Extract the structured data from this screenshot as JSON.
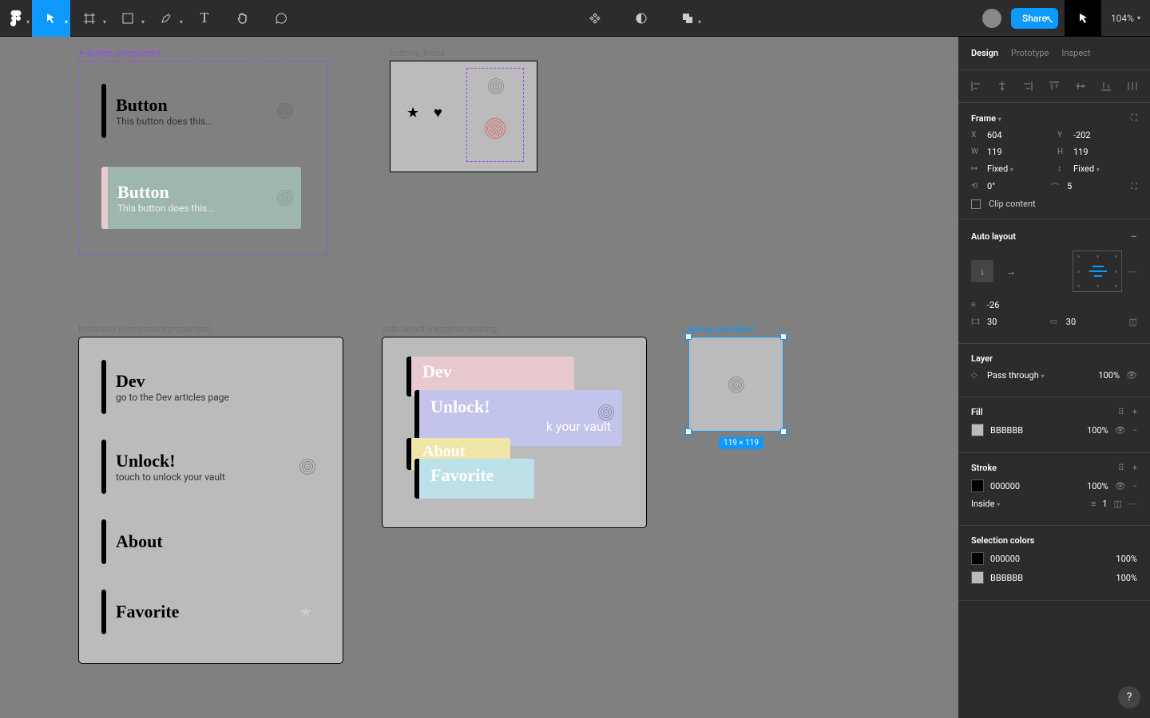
{
  "toolbar": {
    "share_label": "Share",
    "zoom": "104%"
  },
  "canvas": {
    "frames": {
      "button_component": {
        "label": "button_component",
        "variants": [
          {
            "title": "Button",
            "subtitle": "This button does this..."
          },
          {
            "title": "Button",
            "subtitle": "This button does this..."
          }
        ]
      },
      "buttons_icons": {
        "label": "buttons_icons"
      },
      "instances": {
        "label": "Instances (component properties)",
        "items": [
          {
            "title": "Dev",
            "subtitle": "go to the Dev articles page"
          },
          {
            "title": "Unlock!",
            "subtitle": "touch to unlock your vault"
          },
          {
            "title": "About",
            "subtitle": ""
          },
          {
            "title": "Favorite",
            "subtitle": ""
          }
        ]
      },
      "autolayout": {
        "label": "auto-layout (negative spacing)",
        "items": [
          {
            "title": "Dev"
          },
          {
            "title": "Unlock!",
            "subtitle": "k your vault"
          },
          {
            "title": "About"
          },
          {
            "title": "Favorite"
          }
        ]
      },
      "spring": {
        "label": "spring animation",
        "badge": "119 × 119"
      }
    }
  },
  "panel": {
    "tabs": {
      "design": "Design",
      "prototype": "Prototype",
      "inspect": "Inspect"
    },
    "frame": {
      "title": "Frame",
      "x": "604",
      "y": "-202",
      "w": "119",
      "h": "119",
      "constrainW": "Fixed",
      "constrainH": "Fixed",
      "rotation": "0°",
      "radius": "5",
      "clip": "Clip content"
    },
    "autolayout": {
      "title": "Auto layout",
      "spacing": "-26",
      "padH": "30",
      "padV": "30"
    },
    "layer": {
      "title": "Layer",
      "blend": "Pass through",
      "opacity": "100%"
    },
    "fill": {
      "title": "Fill",
      "color": "BBBBBB",
      "opacity": "100%"
    },
    "stroke": {
      "title": "Stroke",
      "color": "000000",
      "opacity": "100%",
      "pos": "Inside",
      "width": "1"
    },
    "selection": {
      "title": "Selection colors",
      "colors": [
        {
          "hex": "000000",
          "opacity": "100%"
        },
        {
          "hex": "BBBBBB",
          "opacity": "100%"
        }
      ]
    }
  }
}
